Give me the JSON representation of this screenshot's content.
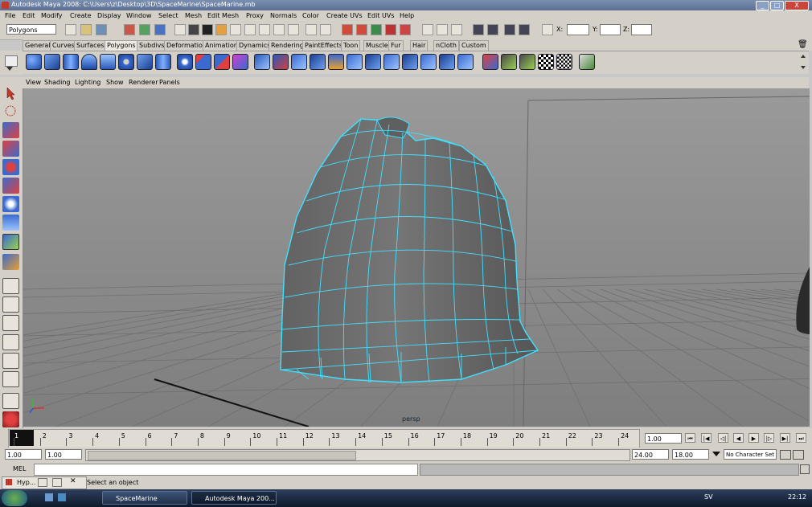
{
  "window": {
    "title": "Autodesk Maya 2008: C:\\Users\\z\\Desktop\\3D\\SpaceMarine\\SpaceMarine.mb",
    "minimize": "_",
    "maximize": "□",
    "close": "X"
  },
  "menubar": [
    "File",
    "Edit",
    "Modify",
    "Create",
    "Display",
    "Window",
    "Select",
    "Mesh",
    "Edit Mesh",
    "Proxy",
    "Normals",
    "Color",
    "Create UVs",
    "Edit UVs",
    "Help"
  ],
  "statusline": {
    "menuset": "Polygons",
    "x_label": "X:",
    "y_label": "Y:",
    "z_label": "Z:"
  },
  "shelf_tabs": [
    "General",
    "Curves",
    "Surfaces",
    "Polygons",
    "Subdivs",
    "Deformation",
    "Animation",
    "Dynamics",
    "Rendering",
    "PaintEffects",
    "Toon",
    "Muscle",
    "Fur",
    "Hair",
    "nCloth",
    "Custom"
  ],
  "active_shelf_tab": "Polygons",
  "panel_menu": [
    "View",
    "Shading",
    "Lighting",
    "Show",
    "Renderer",
    "Panels"
  ],
  "viewport": {
    "camera_label": "persp",
    "wire_color": "#40e0ff",
    "mesh_color": "#6a6a6a",
    "background": "#8f8f8f"
  },
  "timeslider": {
    "ticks": [
      "1",
      "2",
      "3",
      "4",
      "5",
      "6",
      "7",
      "8",
      "9",
      "10",
      "11",
      "12",
      "13",
      "14",
      "15",
      "16",
      "17",
      "18",
      "19",
      "20",
      "21",
      "22",
      "23",
      "24"
    ],
    "current_frame": "1.00"
  },
  "rangeslider": {
    "start": "1.00",
    "start2": "1.00",
    "end": "24.00",
    "end2": "18.00",
    "character_set": "No Character Set"
  },
  "cmdline": {
    "label": "MEL"
  },
  "helpline": {
    "text": "Select an object",
    "hypershade_label": "Hyp..."
  },
  "taskbar": {
    "items": [
      "SpaceMarine",
      "Autodesk Maya 200..."
    ],
    "language": "SV",
    "clock": "22:12"
  }
}
